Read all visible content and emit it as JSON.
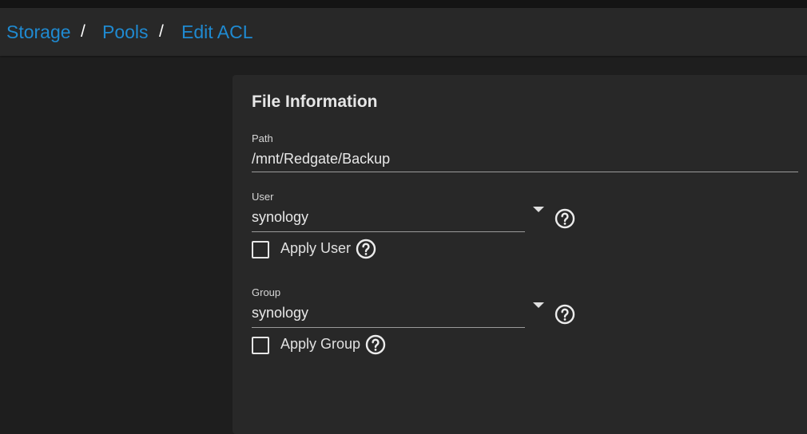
{
  "breadcrumb": {
    "items": [
      "Storage",
      "Pools",
      "Edit ACL"
    ],
    "separator": "/"
  },
  "file_information": {
    "title": "File Information",
    "path": {
      "label": "Path",
      "value": "/mnt/Redgate/Backup"
    },
    "user": {
      "label": "User",
      "value": "synology",
      "apply_label": "Apply User",
      "apply_checked": false
    },
    "group": {
      "label": "Group",
      "value": "synology",
      "apply_label": "Apply Group",
      "apply_checked": false
    }
  },
  "colors": {
    "link": "#1f8ad1",
    "background": "#1e1e1e",
    "card": "#282828",
    "text": "#e8e8e8"
  },
  "icons": {
    "help": "help-circle-icon",
    "dropdown": "chevron-down-icon"
  }
}
